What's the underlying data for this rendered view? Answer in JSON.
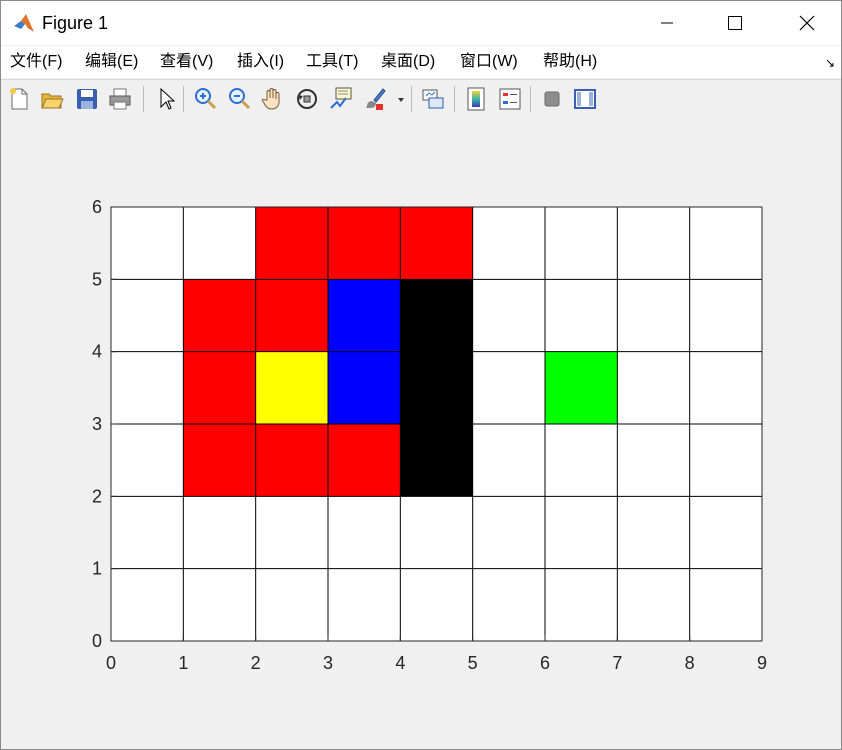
{
  "window": {
    "title": "Figure 1",
    "icon": "matlab-logo-icon"
  },
  "menu": [
    "文件(F)",
    "编辑(E)",
    "查看(V)",
    "插入(I)",
    "工具(T)",
    "桌面(D)",
    "窗口(W)",
    "帮助(H)"
  ],
  "toolbar": {
    "icons": [
      "new-figure-icon",
      "open-file-icon",
      "save-icon",
      "print-icon",
      "edit-plot-pointer-icon",
      "zoom-in-icon",
      "zoom-out-icon",
      "pan-hand-icon",
      "rotate-3d-icon",
      "data-tips-icon",
      "brush-icon",
      "brush-dropdown-icon",
      "link-plot-icon",
      "insert-colorbar-icon",
      "insert-legend-icon",
      "hide-plot-tools-icon",
      "show-plot-tools-icon"
    ]
  },
  "chart_data": {
    "type": "heatmap",
    "xlim": [
      0,
      9
    ],
    "ylim": [
      0,
      6
    ],
    "x_ticks": [
      "0",
      "1",
      "2",
      "3",
      "4",
      "5",
      "6",
      "7",
      "8",
      "9"
    ],
    "y_ticks": [
      "0",
      "1",
      "2",
      "3",
      "4",
      "5",
      "6"
    ],
    "grid": true,
    "background_color": "#ffffff",
    "cells": [
      {
        "x": 2,
        "y": 5,
        "color": "#ff0000"
      },
      {
        "x": 3,
        "y": 5,
        "color": "#ff0000"
      },
      {
        "x": 4,
        "y": 5,
        "color": "#ff0000"
      },
      {
        "x": 1,
        "y": 4,
        "color": "#ff0000"
      },
      {
        "x": 2,
        "y": 4,
        "color": "#ff0000"
      },
      {
        "x": 3,
        "y": 4,
        "color": "#0000ff"
      },
      {
        "x": 4,
        "y": 4,
        "color": "#000000"
      },
      {
        "x": 1,
        "y": 3,
        "color": "#ff0000"
      },
      {
        "x": 2,
        "y": 3,
        "color": "#ffff00"
      },
      {
        "x": 3,
        "y": 3,
        "color": "#0000ff"
      },
      {
        "x": 4,
        "y": 3,
        "color": "#000000"
      },
      {
        "x": 6,
        "y": 3,
        "color": "#00ff00"
      },
      {
        "x": 1,
        "y": 2,
        "color": "#ff0000"
      },
      {
        "x": 2,
        "y": 2,
        "color": "#ff0000"
      },
      {
        "x": 3,
        "y": 2,
        "color": "#ff0000"
      },
      {
        "x": 4,
        "y": 2,
        "color": "#000000"
      }
    ]
  }
}
